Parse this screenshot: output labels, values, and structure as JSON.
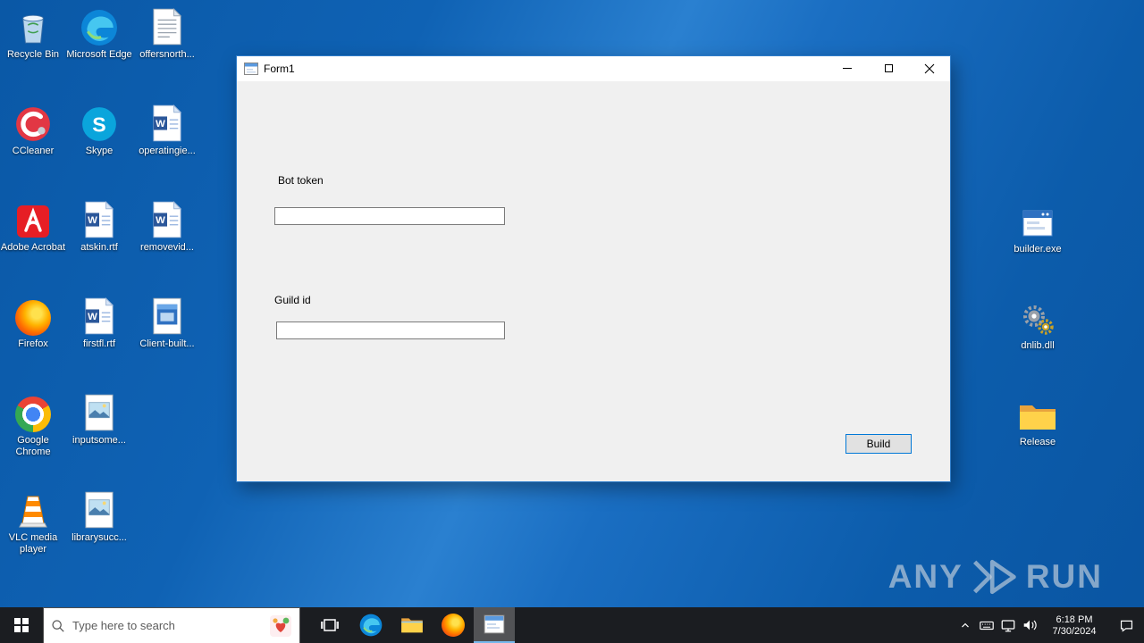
{
  "colors": {
    "accent": "#0078d7",
    "desktop_blue": "#1166b8",
    "taskbar_bg": "#1b1d21",
    "window_bg": "#f0f0f0",
    "titlebar_bg": "#ffffff"
  },
  "window": {
    "title": "Form1"
  },
  "form": {
    "bot_token_label": "Bot token",
    "bot_token_value": "",
    "guild_id_label": "Guild id",
    "guild_id_value": "",
    "build_button_label": "Build"
  },
  "desktop": {
    "left_icons": [
      {
        "label": "Recycle Bin",
        "icon": "recycle-bin"
      },
      {
        "label": "Microsoft Edge",
        "icon": "edge"
      },
      {
        "label": "offersnorth...",
        "icon": "text-doc"
      },
      {
        "label": "CCleaner",
        "icon": "ccleaner"
      },
      {
        "label": "Skype",
        "icon": "skype"
      },
      {
        "label": "operatingie...",
        "icon": "word-doc"
      },
      {
        "label": "Adobe Acrobat",
        "icon": "acrobat"
      },
      {
        "label": "atskin.rtf",
        "icon": "word-doc"
      },
      {
        "label": "removevid...",
        "icon": "word-doc"
      },
      {
        "label": "Firefox",
        "icon": "firefox"
      },
      {
        "label": "firstfl.rtf",
        "icon": "word-doc"
      },
      {
        "label": "Client-built...",
        "icon": "image-doc"
      },
      {
        "label": "Google Chrome",
        "icon": "chrome"
      },
      {
        "label": "inputsome...",
        "icon": "image-doc"
      },
      {
        "label": "VLC media player",
        "icon": "vlc"
      },
      {
        "label": "librarysucc...",
        "icon": "image-doc"
      }
    ],
    "right_icons": [
      {
        "label": "builder.exe",
        "icon": "app-window"
      },
      {
        "label": "dnlib.dll",
        "icon": "gears"
      },
      {
        "label": "Release",
        "icon": "folder"
      }
    ]
  },
  "taskbar": {
    "search_placeholder": "Type here to search",
    "clock": {
      "time": "6:18 PM",
      "date": "7/30/2024"
    }
  },
  "watermark": {
    "left": "ANY",
    "right": "RUN"
  }
}
